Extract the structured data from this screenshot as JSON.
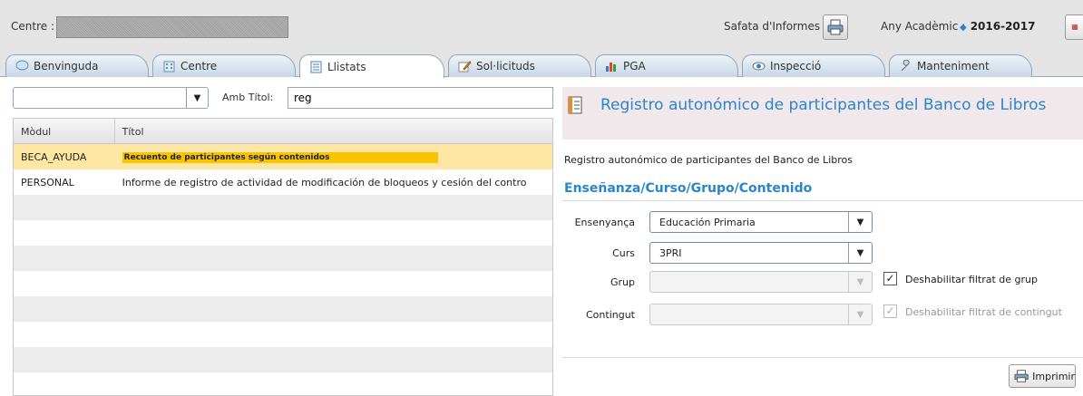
{
  "topbar": {
    "centre_label": "Centre :",
    "safata_label": "Safata d'Informes",
    "any_label": "Any Acadèmic :",
    "any_value": "2016-2017"
  },
  "tabs": [
    {
      "label": "Benvinguda",
      "icon": "speech-bubble-icon"
    },
    {
      "label": "Centre",
      "icon": "building-icon"
    },
    {
      "label": "Llistats",
      "icon": "list-document-icon",
      "active": true
    },
    {
      "label": "Sol·licituds",
      "icon": "pencil-icon"
    },
    {
      "label": "PGA",
      "icon": "bar-chart-icon"
    },
    {
      "label": "Inspecció",
      "icon": "eye-icon"
    },
    {
      "label": "Manteniment",
      "icon": "wrench-icon"
    }
  ],
  "left": {
    "module_select_value": "",
    "amb_label": "Amb Títol:",
    "amb_value": "reg",
    "columns": [
      "Mòdul",
      "Títol"
    ],
    "rows": [
      {
        "module": "BECA_AYUDA",
        "title": "Recuento de participantes según contenidos",
        "selected": true
      },
      {
        "module": "PERSONAL",
        "title": "Informe de registro de actividad de modificación de bloqueos y cesión del contro"
      }
    ]
  },
  "right": {
    "title": "Registro autonómico de participantes del Banco de Libros",
    "subtitle": "Registro autonómico de participantes del Banco de Libros",
    "section_title": "Enseñanza/Curso/Grupo/Contenido",
    "fields": {
      "ensenyanca_label": "Ensenyança",
      "ensenyanca_value": "Educación Primaria",
      "curs_label": "Curs",
      "curs_value": "3PRI",
      "grup_label": "Grup",
      "grup_value": "",
      "contingut_label": "Contingut",
      "contingut_value": ""
    },
    "grup_checkbox_label": "Deshabilitar filtrat de grup",
    "contingut_checkbox_label": "Deshabilitar filtrat de contingut",
    "print_label": "Imprimir"
  }
}
